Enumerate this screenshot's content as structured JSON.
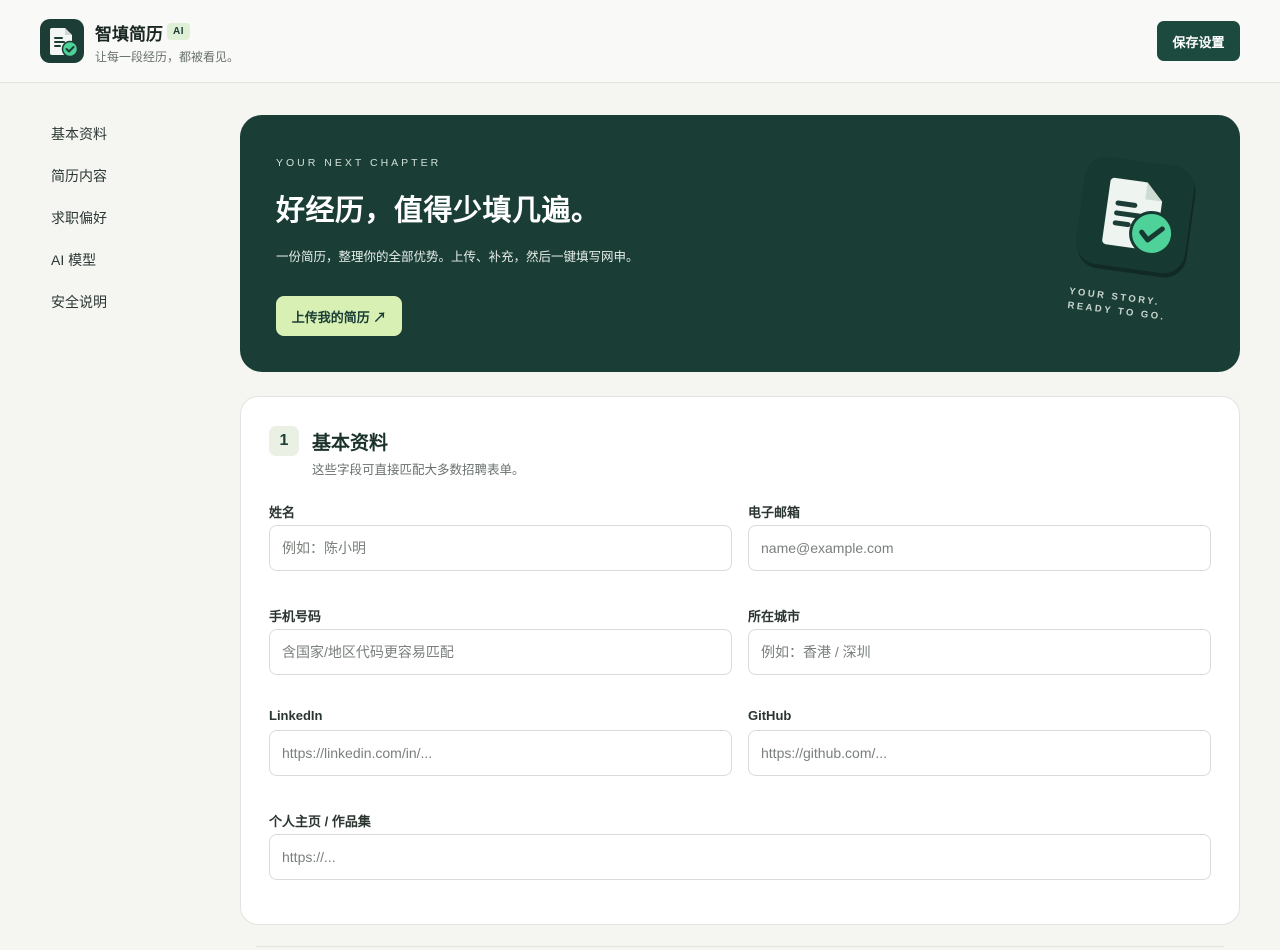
{
  "header": {
    "brand_name": "智填简历",
    "badge": "AI",
    "tagline": "让每一段经历，都被看见。",
    "save_label": "保存设置"
  },
  "sidebar": {
    "items": [
      {
        "label": "基本资料"
      },
      {
        "label": "简历内容"
      },
      {
        "label": "求职偏好"
      },
      {
        "label": "AI 模型"
      },
      {
        "label": "安全说明"
      }
    ]
  },
  "hero": {
    "eyebrow": "YOUR NEXT CHAPTER",
    "title": "好经历，值得少填几遍。",
    "subtitle": "一份简历，整理你的全部优势。上传、补充，然后一键填写网申。",
    "button_label": "上传我的简历 ↗",
    "art_caption_line1": "YOUR STORY.",
    "art_caption_line2": "READY TO GO.",
    "colors": {
      "background": "#1a3d36",
      "accent": "#d8f0b4",
      "check": "#4fd19a"
    }
  },
  "form": {
    "step": "1",
    "title": "基本资料",
    "description": "这些字段可直接匹配大多数招聘表单。",
    "fields": [
      {
        "label": "姓名",
        "value": "",
        "placeholder": "例如：陈小明"
      },
      {
        "label": "电子邮箱",
        "value": "",
        "placeholder": "name@example.com"
      },
      {
        "label": "手机号码",
        "value": "",
        "placeholder": "含国家/地区代码更容易匹配"
      },
      {
        "label": "所在城市",
        "value": "",
        "placeholder": "例如：香港 / 深圳"
      },
      {
        "label": "LinkedIn",
        "value": "",
        "placeholder": "https://linkedin.com/in/..."
      },
      {
        "label": "GitHub",
        "value": "",
        "placeholder": "https://github.com/..."
      },
      {
        "label": "个人主页 / 作品集",
        "value": "",
        "placeholder": "https://..."
      }
    ]
  }
}
